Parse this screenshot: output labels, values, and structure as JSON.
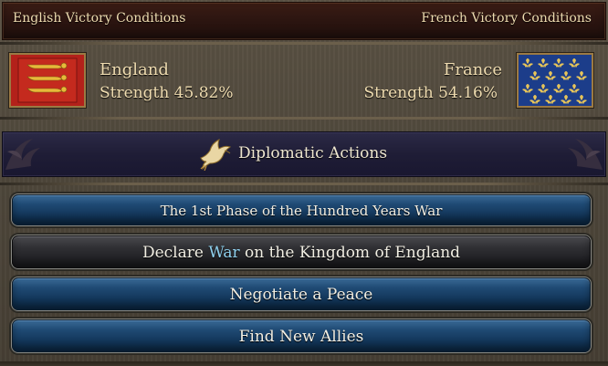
{
  "victory": {
    "english_label": "English Victory Conditions",
    "french_label": "French Victory Conditions"
  },
  "nations": {
    "left": {
      "name": "England",
      "strength": "Strength 45.82%",
      "emblem": "england-coat-of-arms-icon",
      "color": "#a61d16"
    },
    "right": {
      "name": "France",
      "strength": "Strength 54.16%",
      "emblem": "france-fleur-de-lis-icon",
      "color": "#1c3d8a"
    }
  },
  "diplomacy": {
    "title": "Diplomatic Actions",
    "icon": "dove-icon"
  },
  "actions": {
    "phase": "The 1st Phase of the Hundred Years War",
    "declare_prefix": "Declare",
    "declare_highlight": "War",
    "declare_suffix": "on the Kingdom of England",
    "peace": "Negotiate a Peace",
    "allies": "Find New Allies"
  },
  "colors": {
    "text": "#efdcb0",
    "button_blue": "#1f4a74",
    "button_dark": "#303034",
    "highlight": "#8fd0ee"
  }
}
